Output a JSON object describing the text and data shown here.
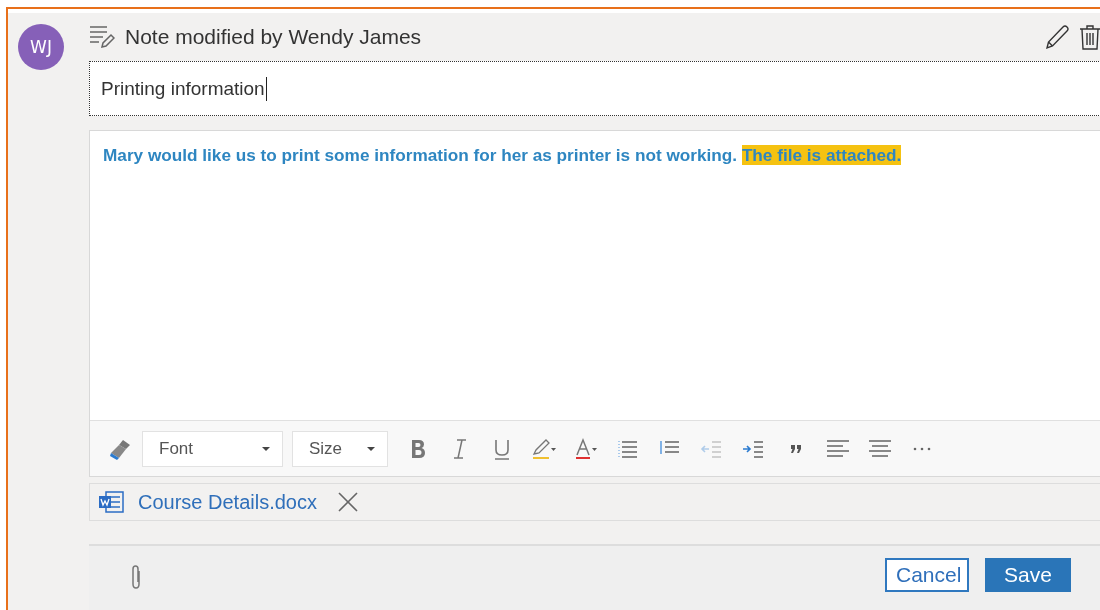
{
  "avatar": {
    "initials": "WJ"
  },
  "header": {
    "title": "Note modified by Wendy James"
  },
  "subject": {
    "value": "Printing information"
  },
  "body": {
    "segments": [
      {
        "text": "Mary would like us to print some information for her as printer is not working.  ",
        "highlighted": false
      },
      {
        "text": "The file is attached.",
        "highlighted": true
      }
    ]
  },
  "toolbar": {
    "font": "Font",
    "size": "Size",
    "buttons": [
      {
        "kind": "bold",
        "disabled": false
      },
      {
        "kind": "italic",
        "disabled": false
      },
      {
        "kind": "underline",
        "disabled": false
      },
      {
        "kind": "highlight",
        "disabled": false
      },
      {
        "kind": "font-color",
        "disabled": false
      },
      {
        "kind": "bullets",
        "disabled": false
      },
      {
        "kind": "numbering",
        "disabled": false
      },
      {
        "kind": "outdent",
        "disabled": true
      },
      {
        "kind": "indent",
        "disabled": false
      },
      {
        "kind": "quote",
        "disabled": false
      },
      {
        "kind": "align-left",
        "disabled": false
      },
      {
        "kind": "align-center",
        "disabled": false
      },
      {
        "kind": "more",
        "disabled": false
      }
    ]
  },
  "attachment": {
    "name": "Course Details.docx"
  },
  "buttons": [
    {
      "label": "Cancel",
      "kind": "secondary"
    },
    {
      "label": "Save",
      "kind": "primary"
    }
  ]
}
